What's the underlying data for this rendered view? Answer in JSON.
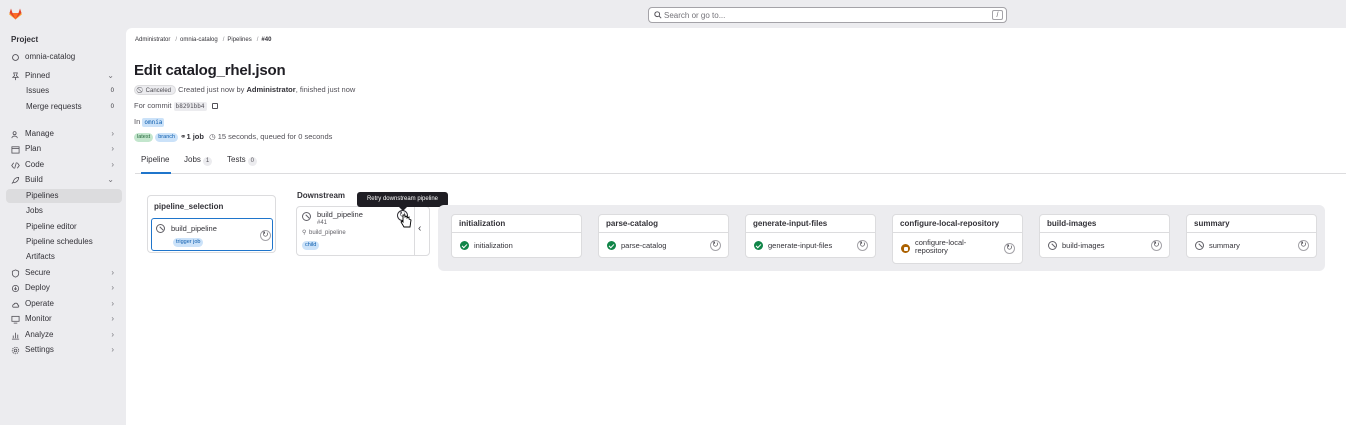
{
  "search": {
    "placeholder": "Search or go to...",
    "shortcut": "/"
  },
  "sidebar": {
    "section_title": "Project",
    "project_name": "omnia-catalog",
    "pinned": {
      "label": "Pinned",
      "items": [
        {
          "label": "Issues",
          "count": "0"
        },
        {
          "label": "Merge requests",
          "count": "0"
        }
      ]
    },
    "groups": [
      {
        "label": "Manage",
        "icon": "users-icon"
      },
      {
        "label": "Plan",
        "icon": "calendar-icon"
      },
      {
        "label": "Code",
        "icon": "code-icon"
      },
      {
        "label": "Build",
        "icon": "rocket-icon"
      }
    ],
    "build_items": [
      {
        "label": "Pipelines",
        "active": true
      },
      {
        "label": "Jobs"
      },
      {
        "label": "Pipeline editor"
      },
      {
        "label": "Pipeline schedules"
      },
      {
        "label": "Artifacts"
      }
    ],
    "more_groups": [
      {
        "label": "Secure",
        "icon": "shield-icon"
      },
      {
        "label": "Deploy",
        "icon": "deploy-icon"
      },
      {
        "label": "Operate",
        "icon": "cloud-icon"
      },
      {
        "label": "Monitor",
        "icon": "monitor-icon"
      },
      {
        "label": "Analyze",
        "icon": "chart-icon"
      },
      {
        "label": "Settings",
        "icon": "gear-icon"
      }
    ]
  },
  "breadcrumb": [
    "Administrator",
    "omnia-catalog",
    "Pipelines",
    "#40"
  ],
  "page": {
    "title": "Edit catalog_rhel.json",
    "status_label": "Canceled",
    "created_prefix": "Created just now by",
    "author": "Administrator",
    "created_suffix": ", finished just now",
    "for_commit": "For commit",
    "commit_sha": "b8291bb4",
    "in_label": "In",
    "ref": "omnia",
    "tag_latest": "latest",
    "tag_branch": "branch",
    "jobs_count": "1 job",
    "duration": "15 seconds, queued for 0 seconds"
  },
  "tabs": [
    {
      "label": "Pipeline",
      "count": ""
    },
    {
      "label": "Jobs",
      "count": "1"
    },
    {
      "label": "Tests",
      "count": "0"
    }
  ],
  "graph": {
    "upstream_stage": {
      "title": "pipeline_selection",
      "job": "build_pipeline",
      "tag": "trigger job"
    },
    "downstream": {
      "title": "Downstream",
      "pipeline_name": "build_pipeline",
      "pipeline_id": "#41",
      "source_job": "build_pipeline",
      "tag": "child",
      "tooltip": "Retry downstream pipeline"
    },
    "stages": [
      {
        "title": "initialization",
        "job": "initialization",
        "status": "success"
      },
      {
        "title": "parse-catalog",
        "job": "parse-catalog",
        "status": "success"
      },
      {
        "title": "generate-input-files",
        "job": "generate-input-files",
        "status": "success"
      },
      {
        "title": "configure-local-repository",
        "job": "configure-local-repository",
        "status": "created"
      },
      {
        "title": "build-images",
        "job": "build-images",
        "status": "canceled"
      },
      {
        "title": "summary",
        "job": "summary",
        "status": "canceled"
      }
    ]
  }
}
